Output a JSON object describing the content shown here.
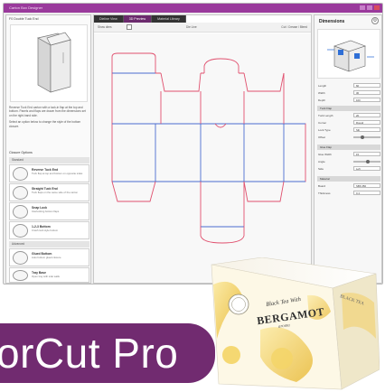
{
  "window": {
    "title": "Carton Box Designer"
  },
  "left_panel": {
    "title": "F0 Double Tuck End",
    "description": [
      "Reverse Tuck End carton with a tuck-in flap at the top and bottom. Panels and flaps are drawn from the dimensions set on the right-hand side.",
      "Select an option below to change the style of the bottom closure."
    ],
    "section_label": "Closure Options",
    "group_header": "Standard",
    "options": [
      {
        "title": "Reverse Tuck End",
        "desc": "Tuck flap at top and bottom on opposite sides"
      },
      {
        "title": "Straight Tuck End",
        "desc": "Tuck flaps on the same side of the carton"
      },
      {
        "title": "Snap Lock",
        "desc": "Interlocking bottom flaps"
      },
      {
        "title": "1-2-3 Bottom",
        "desc": "Crash lock style bottom"
      }
    ],
    "group_header_2": "Advanced",
    "options_2": [
      {
        "title": "Glued Bottom",
        "desc": "Auto bottom glued closure"
      },
      {
        "title": "Tray Base",
        "desc": "Open tray with side walls"
      }
    ]
  },
  "canvas": {
    "tabs": [
      "Dieline View",
      "3D Preview",
      "Material Library"
    ],
    "active_tab": 1,
    "toolbar_left": "Show dims",
    "toolbar_center": "Die Line",
    "toolbar_right": "Cut / Crease / Bleed"
  },
  "right_panel": {
    "title": "Dimensions",
    "rows_top": [
      {
        "label": "Length",
        "value": "60"
      },
      {
        "label": "Width",
        "value": "30"
      },
      {
        "label": "Depth",
        "value": "100"
      }
    ],
    "head_1": "Tuck Flap",
    "rows_mid": [
      {
        "label": "Tuck Length",
        "value": "20"
      },
      {
        "label": "Corner",
        "value": "Round"
      },
      {
        "label": "Lock Type",
        "value": "Slit"
      },
      {
        "label": "Offset",
        "value": "2"
      }
    ],
    "head_2": "Glue Flap",
    "rows_low": [
      {
        "label": "Glue Width",
        "value": "15"
      },
      {
        "label": "Angle",
        "value": "15"
      },
      {
        "label": "Side",
        "value": "Left"
      }
    ],
    "head_3": "Material",
    "rows_end": [
      {
        "label": "Board",
        "value": "SBS 350"
      },
      {
        "label": "Thickness",
        "value": "0.4"
      }
    ]
  },
  "product": {
    "brand_line1": "Black Tea With",
    "brand_name": "BERGAMOT",
    "brand_line2": "aroma"
  },
  "banner": {
    "text": "orCut Pro"
  },
  "colors": {
    "accent": "#712b70",
    "cut_line": "#e0506e",
    "crease_line": "#4a6ccf"
  }
}
